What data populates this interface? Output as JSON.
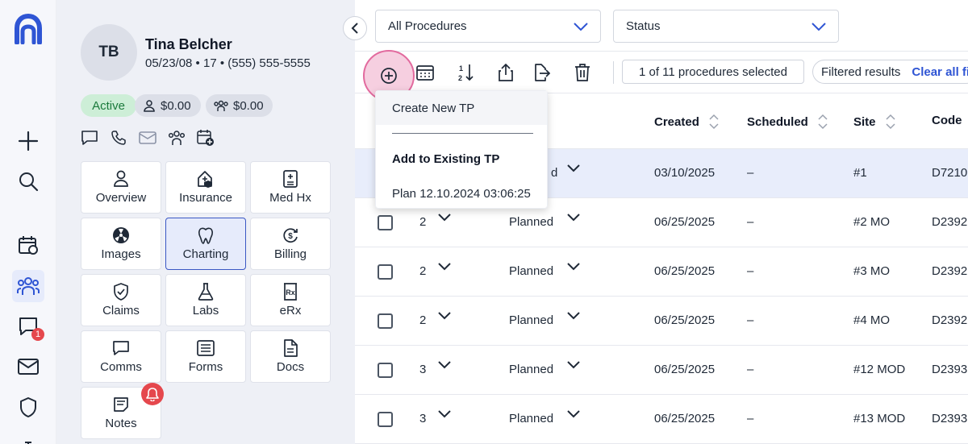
{
  "patient": {
    "initials": "TB",
    "name": "Tina Belcher",
    "info": "05/23/08 • 17 • (555) 555-5555",
    "status": "Active",
    "balance_patient": "$0.00",
    "balance_family": "$0.00"
  },
  "tiles": [
    {
      "label": "Overview",
      "icon": "person-icon"
    },
    {
      "label": "Insurance",
      "icon": "insurance-icon"
    },
    {
      "label": "Med Hx",
      "icon": "med-hx-icon"
    },
    {
      "label": "Images",
      "icon": "radiation-icon"
    },
    {
      "label": "Charting",
      "icon": "tooth-icon"
    },
    {
      "label": "Billing",
      "icon": "billing-icon"
    },
    {
      "label": "Claims",
      "icon": "shield-icon"
    },
    {
      "label": "Labs",
      "icon": "flask-icon"
    },
    {
      "label": "eRx",
      "icon": "rx-icon"
    },
    {
      "label": "Comms",
      "icon": "chat-icon"
    },
    {
      "label": "Forms",
      "icon": "form-icon"
    },
    {
      "label": "Docs",
      "icon": "document-icon"
    },
    {
      "label": "Notes",
      "icon": "notes-icon"
    }
  ],
  "rail": {
    "messages_badge": "1"
  },
  "filters": {
    "procedures": "All Procedures",
    "status": "Status"
  },
  "toolbar": {
    "selected_count": "1 of 11 procedures selected",
    "filtered_label": "Filtered results",
    "clear_label": "Clear all fi"
  },
  "table": {
    "headers": {
      "created": "Created",
      "scheduled": "Scheduled",
      "site": "Site",
      "code": "Code"
    },
    "rows": [
      {
        "num": "",
        "status": "d",
        "created": "03/10/2025",
        "scheduled": "–",
        "site": "#1",
        "code": "D7210"
      },
      {
        "num": "2",
        "status": "Planned",
        "created": "06/25/2025",
        "scheduled": "–",
        "site": "#2 MO",
        "code": "D2392"
      },
      {
        "num": "2",
        "status": "Planned",
        "created": "06/25/2025",
        "scheduled": "–",
        "site": "#3 MO",
        "code": "D2392"
      },
      {
        "num": "2",
        "status": "Planned",
        "created": "06/25/2025",
        "scheduled": "–",
        "site": "#4 MO",
        "code": "D2392"
      },
      {
        "num": "3",
        "status": "Planned",
        "created": "06/25/2025",
        "scheduled": "–",
        "site": "#12 MOD",
        "code": "D2393"
      },
      {
        "num": "3",
        "status": "Planned",
        "created": "06/25/2025",
        "scheduled": "–",
        "site": "#13 MOD",
        "code": "D2393"
      }
    ]
  },
  "menu": {
    "create_new": "Create New TP",
    "add_existing": "Add to Existing TP",
    "plan_item": "Plan 12.10.2024 03:06:25"
  },
  "colors": {
    "brand": "#2f55d4",
    "highlight_row": "#e8edfb",
    "active_chip": "#cdeed7",
    "badge": "#e5484d",
    "add_button_ring": "#e26a9e"
  }
}
